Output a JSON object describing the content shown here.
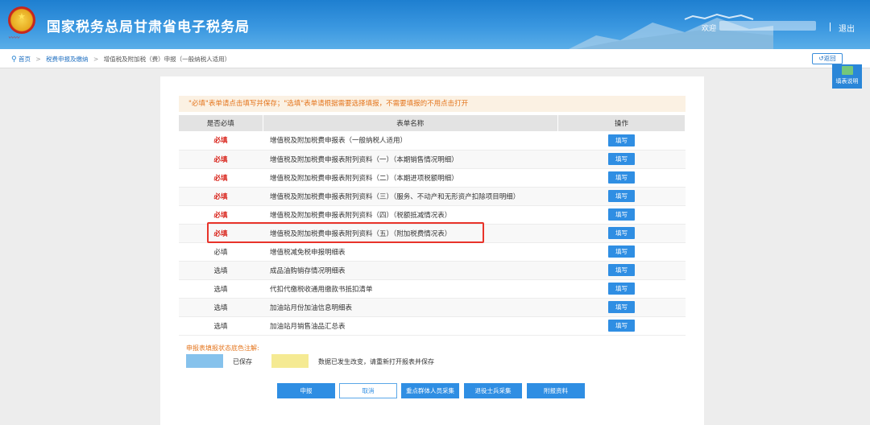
{
  "header": {
    "title": "国家税务总局甘肃省电子税务局",
    "welcome": "欢迎",
    "logout": "退出"
  },
  "breadcrumb": {
    "home": "首页",
    "level1": "税费申报及缴纳",
    "current": "增值税及附加税（费）申报（一般纳税人适用）"
  },
  "back_button": "返回",
  "help_side": "填表说明",
  "notice": "\"必填\"表单请点击填写并保存；\"选填\"表单请根据需要选择填报，不需要填报的不用点击打开",
  "table": {
    "headers": [
      "是否必填",
      "表单名称",
      "操作"
    ],
    "rows": [
      {
        "required": "必填",
        "name": "增值税及附加税费申报表（一般纳税人适用）",
        "action": "填写"
      },
      {
        "required": "必填",
        "name": "增值税及附加税费申报表附列资料（一）（本期销售情况明细）",
        "action": "填写"
      },
      {
        "required": "必填",
        "name": "增值税及附加税费申报表附列资料（二）（本期进项税额明细）",
        "action": "填写"
      },
      {
        "required": "必填",
        "name": "增值税及附加税费申报表附列资料（三）（服务、不动产和无形资产扣除项目明细）",
        "action": "填写"
      },
      {
        "required": "必填",
        "name": "增值税及附加税费申报表附列资料（四）（税额抵减情况表）",
        "action": "填写"
      },
      {
        "required": "必填",
        "name": "增值税及附加税费申报表附列资料（五）（附加税费情况表）",
        "action": "填写"
      },
      {
        "required": "必填",
        "name": "增值税减免税申报明细表",
        "action": "填写"
      },
      {
        "required": "选填",
        "name": "成品油购销存情况明细表",
        "action": "填写"
      },
      {
        "required": "选填",
        "name": "代扣代缴税收通用缴款书抵扣清单",
        "action": "填写"
      },
      {
        "required": "选填",
        "name": "加油站月份加油信息明细表",
        "action": "填写"
      },
      {
        "required": "选填",
        "name": "加油站月销售油品汇总表",
        "action": "填写"
      }
    ]
  },
  "legend": {
    "title": "申报表填报状态底色注解:",
    "saved": "已保存",
    "changed": "数据已发生改变，请重新打开报表并保存"
  },
  "buttons": {
    "submit": "申报",
    "cancel": "取消",
    "key_group": "重点群体人员采集",
    "veteran": "退役士兵采集",
    "attachment": "附报资料"
  },
  "colors": {
    "header_blue": "#1e7fd0",
    "required_red": "#d9251c",
    "notice_orange": "#e4751d",
    "button_blue": "#2f8ee3",
    "saved_color": "#86c2ec",
    "changed_color": "#f5ea93",
    "highlight_red": "#e8332a"
  }
}
